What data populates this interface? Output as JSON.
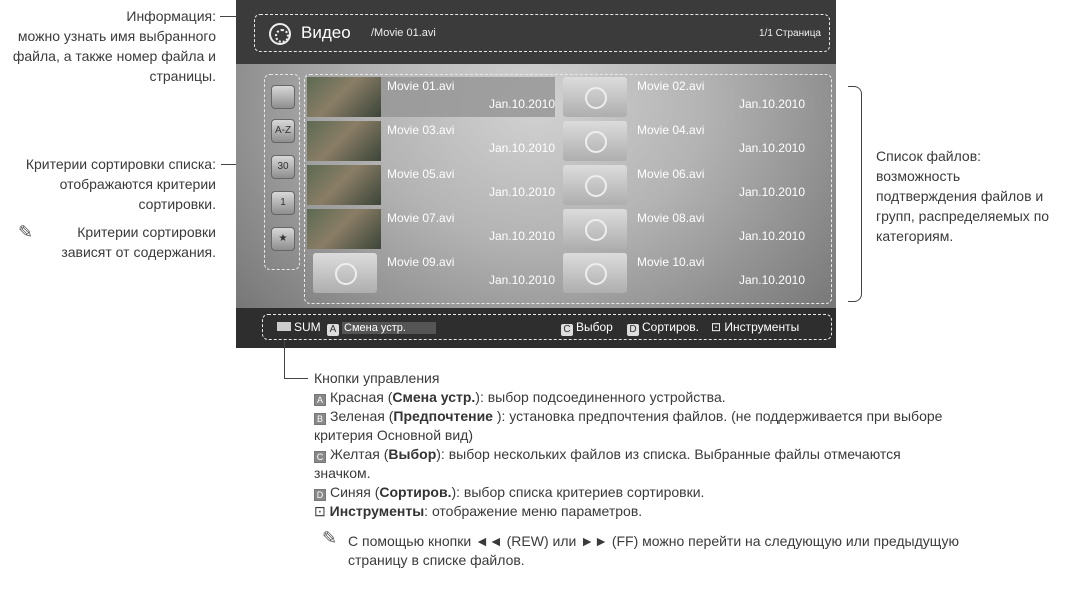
{
  "annotations": {
    "info_line1": "Информация:",
    "info_line2": "можно узнать имя выбранного",
    "info_line3": "файла, а также номер файла и",
    "info_line4": "страницы.",
    "sort_line1": "Критерии сортировки списка:",
    "sort_line2": "отображаются критерии",
    "sort_line3": "сортировки.",
    "sort_note1": "Критерии сортировки",
    "sort_note2": "зависят от содержания.",
    "list_line1": "Список файлов:",
    "list_line2": "возможность",
    "list_line3": "подтверждения файлов и",
    "list_line4": "групп, распределяемых по",
    "list_line5": "категориям."
  },
  "screen": {
    "header": {
      "title": "Видео",
      "file": "/Movie 01.avi",
      "page": "1/1 Страница"
    },
    "sort_icons": [
      {
        "name": "folder-icon",
        "label": ""
      },
      {
        "name": "alphabetical-icon",
        "label": "A-Z"
      },
      {
        "name": "calendar-icon",
        "label": "30"
      },
      {
        "name": "calendar-month-icon",
        "label": "1"
      },
      {
        "name": "favorite-star-icon",
        "label": "★"
      }
    ],
    "files": [
      {
        "name": "Movie 01.avi",
        "date": "Jan.10.2010"
      },
      {
        "name": "Movie 02.avi",
        "date": "Jan.10.2010"
      },
      {
        "name": "Movie 03.avi",
        "date": "Jan.10.2010"
      },
      {
        "name": "Movie 04.avi",
        "date": "Jan.10.2010"
      },
      {
        "name": "Movie 05.avi",
        "date": "Jan.10.2010"
      },
      {
        "name": "Movie 06.avi",
        "date": "Jan.10.2010"
      },
      {
        "name": "Movie 07.avi",
        "date": "Jan.10.2010"
      },
      {
        "name": "Movie 08.avi",
        "date": "Jan.10.2010"
      },
      {
        "name": "Movie 09.avi",
        "date": "Jan.10.2010"
      },
      {
        "name": "Movie 10.avi",
        "date": "Jan.10.2010"
      }
    ],
    "bottom": {
      "sum": "SUM",
      "key_a": "A",
      "device": "Смена устр.",
      "key_c": "C",
      "select": "Выбор",
      "key_d": "D",
      "sort": "Сортиров.",
      "tools": "Инструменты"
    }
  },
  "controls": {
    "heading": "Кнопки управления",
    "a_key": "A",
    "a_prefix": "Красная (",
    "a_bold": "Смена устр.",
    "a_suffix": "): выбор подсоединенного устройства.",
    "b_key": "B",
    "b_prefix": "Зеленая (",
    "b_bold": "Предпочтение",
    "b_suffix": " ): установка предпочтения файлов. (не поддерживается при выборе",
    "b_line2": "критерия Основной вид)",
    "c_key": "C",
    "c_prefix": "Желтая (",
    "c_bold": "Выбор",
    "c_suffix": "): выбор нескольких файлов из списка. Выбранные файлы отмечаются",
    "c_line2": "значком.",
    "d_key": "D",
    "d_prefix": "Синяя (",
    "d_bold": "Сортиров.",
    "d_suffix": "): выбор списка критериев сортировки.",
    "tools_bold": "Инструменты",
    "tools_suffix": ": отображение меню параметров.",
    "note_line1": "С помощью кнопки ◄◄ (REW) или ►► (FF) можно перейти на следующую или предыдущую",
    "note_line2": "страницу в списке файлов."
  }
}
